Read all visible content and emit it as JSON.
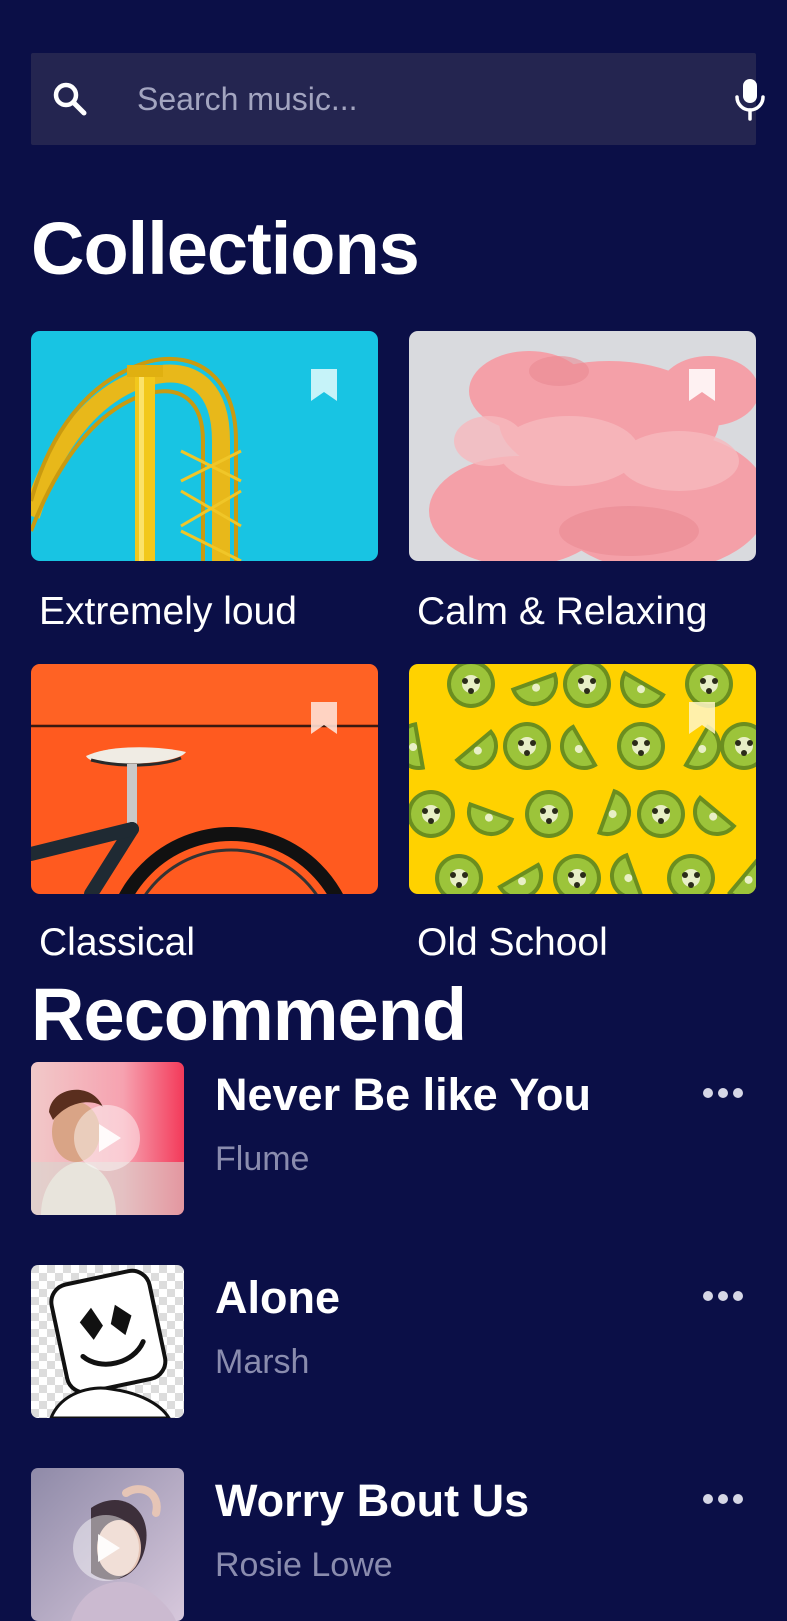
{
  "search": {
    "placeholder": "Search music...",
    "value": ""
  },
  "collections": {
    "title": "Collections",
    "items": [
      {
        "label": "Extremely loud",
        "image": "roller-coaster-image",
        "accent": "#18c4e3"
      },
      {
        "label": "Calm & Relaxing",
        "image": "pink-smoke-image",
        "accent": "#f3a0a8"
      },
      {
        "label": "Classical",
        "image": "bicycle-image",
        "accent": "#ff5a1f"
      },
      {
        "label": "Old School",
        "image": "kiwi-pattern-image",
        "accent": "#ffd200"
      }
    ]
  },
  "recommend": {
    "title": "Recommend",
    "songs": [
      {
        "title": "Never Be like You",
        "artist": "Flume"
      },
      {
        "title": "Alone",
        "artist": "Marsh"
      },
      {
        "title": "Worry Bout Us",
        "artist": "Rosie Lowe"
      }
    ]
  },
  "colors": {
    "background": "#0b0f47",
    "search_bg": "#242550",
    "muted_text": "#8a8cae"
  }
}
